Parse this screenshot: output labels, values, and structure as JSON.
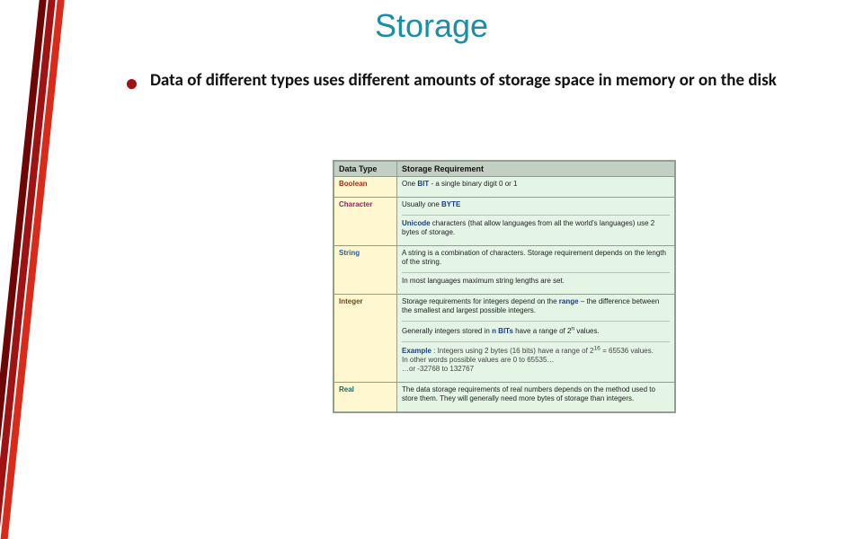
{
  "title": "Storage",
  "bullet": "Data of different types uses different amounts of storage space in memory or on the disk",
  "table": {
    "headers": [
      "Data Type",
      "Storage Requirement"
    ],
    "rows": [
      {
        "type_label": "Boolean",
        "type_class": "type-bool",
        "desc_parts": [
          {
            "text": "One ",
            "cls": ""
          },
          {
            "text": "BIT",
            "cls": "bold-blue"
          },
          {
            "text": " - a single binary digit 0 or 1",
            "cls": ""
          }
        ]
      },
      {
        "type_label": "Character",
        "type_class": "type-char",
        "desc_parts": [
          {
            "text": "Usually one ",
            "cls": ""
          },
          {
            "text": "BYTE",
            "cls": "bold-blue"
          }
        ],
        "desc2_parts": [
          {
            "text": "Unicode",
            "cls": "bold-blue"
          },
          {
            "text": " characters (that allow languages from all the world's languages) use 2 bytes of storage.",
            "cls": ""
          }
        ]
      },
      {
        "type_label": "String",
        "type_class": "type-str",
        "desc_parts": [
          {
            "text": "A string is a combination of characters. Storage requirement depends on the length of the string.",
            "cls": ""
          }
        ],
        "desc2_parts": [
          {
            "text": "In most languages maximum string lengths are set.",
            "cls": ""
          }
        ]
      },
      {
        "type_label": "Integer",
        "type_class": "type-int",
        "desc_parts": [
          {
            "text": "Storage requirements for integers depend on the ",
            "cls": ""
          },
          {
            "text": "range",
            "cls": "bold-blue"
          },
          {
            "text": " – the difference between the smallest and largest possible integers.",
            "cls": ""
          }
        ],
        "desc2_parts": [
          {
            "text": "Generally integers stored in ",
            "cls": ""
          },
          {
            "text": "n BITs",
            "cls": "bold-blue"
          },
          {
            "text": " have a range of 2",
            "cls": ""
          },
          {
            "text": "n",
            "cls": "sup"
          },
          {
            "text": " values.",
            "cls": ""
          }
        ],
        "desc3_parts": [
          {
            "text": "Example",
            "cls": "bold-blue"
          },
          {
            "text": " : Integers using 2 bytes (16 bits) have a range of 2",
            "cls": ""
          },
          {
            "text": "16",
            "cls": "sup"
          },
          {
            "text": " = 65536 values.\nIn other words possible values are 0 to 65535…\n…or -32768 to 132767",
            "cls": ""
          }
        ]
      },
      {
        "type_label": "Real",
        "type_class": "type-real",
        "desc_parts": [
          {
            "text": "The data storage requirements of real numbers depends on the method used to store them. They will generally need more bytes of storage than integers.",
            "cls": ""
          }
        ]
      }
    ]
  },
  "chart_data": {
    "type": "table",
    "title": "Storage",
    "columns": [
      "Data Type",
      "Storage Requirement"
    ],
    "rows": [
      [
        "Boolean",
        "One BIT - a single binary digit 0 or 1"
      ],
      [
        "Character",
        "Usually one BYTE. Unicode characters (that allow languages from all the world's languages) use 2 bytes of storage."
      ],
      [
        "String",
        "A string is a combination of characters. Storage requirement depends on the length of the string. In most languages maximum string lengths are set."
      ],
      [
        "Integer",
        "Storage requirements for integers depend on the range – the difference between the smallest and largest possible integers. Generally integers stored in n BITs have a range of 2^n values. Example: Integers using 2 bytes (16 bits) have a range of 2^16 = 65536 values. In other words possible values are 0 to 65535… …or -32768 to 32767"
      ],
      [
        "Real",
        "The data storage requirements of real numbers depends on the method used to store them. They will generally need more bytes of storage than integers."
      ]
    ]
  }
}
